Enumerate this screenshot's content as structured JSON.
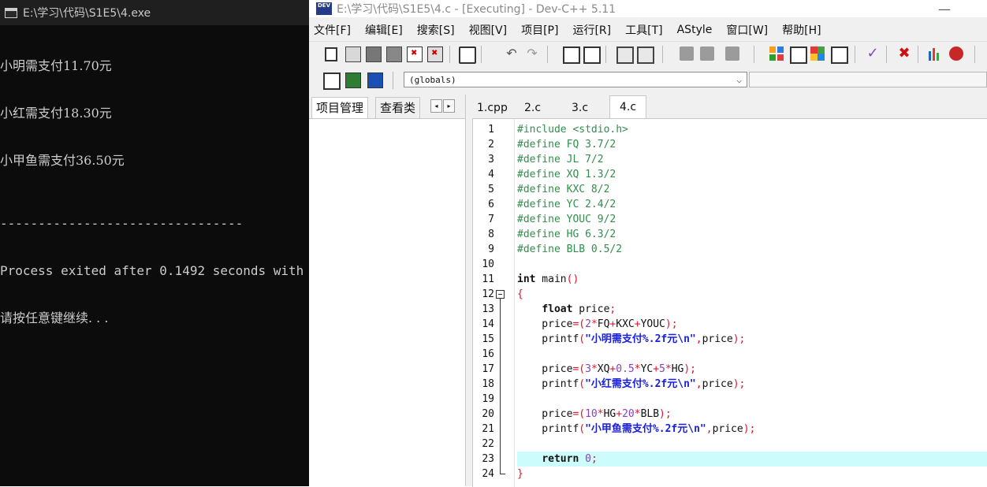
{
  "console": {
    "title": "E:\\学习\\代码\\S1E5\\4.exe",
    "lines": [
      "小明需支付11.70元",
      "小红需支付18.30元",
      "小甲鱼需支付36.50元"
    ],
    "separator": "--------------------------------",
    "exit_message": "Process exited after 0.1492 seconds with",
    "press_key": "请按任意键继续. . ."
  },
  "ide": {
    "title": "E:\\学习\\代码\\S1E5\\4.c - [Executing] - Dev-C++ 5.11",
    "app_icon_text": "DEV",
    "minimize": "—",
    "menu": [
      "文件[F]",
      "编辑[E]",
      "搜索[S]",
      "视图[V]",
      "项目[P]",
      "运行[R]",
      "工具[T]",
      "AStyle",
      "窗口[W]",
      "帮助[H]"
    ],
    "toolbar_icons": {
      "undo": "↶",
      "redo": "↷",
      "check": "✓",
      "stop": "✖"
    },
    "globals_combo": "(globals)",
    "globals_arrow": "⌵",
    "left_panel": {
      "tab_project": "项目管理",
      "tab_class": "查看类",
      "arrow_left": "◂",
      "arrow_right": "▸"
    },
    "editor_tabs": [
      "1.cpp",
      "2.c",
      "3.c",
      "4.c"
    ],
    "active_tab": "4.c"
  },
  "code": {
    "lines": [
      [
        {
          "t": "#include <stdio.h>",
          "c": "pp"
        }
      ],
      [
        {
          "t": "#define FQ 3.7/2",
          "c": "pp"
        }
      ],
      [
        {
          "t": "#define JL 7/2",
          "c": "pp"
        }
      ],
      [
        {
          "t": "#define XQ 1.3/2",
          "c": "pp"
        }
      ],
      [
        {
          "t": "#define KXC 8/2",
          "c": "pp"
        }
      ],
      [
        {
          "t": "#define YC 2.4/2",
          "c": "pp"
        }
      ],
      [
        {
          "t": "#define YOUC 9/2",
          "c": "pp"
        }
      ],
      [
        {
          "t": "#define HG 6.3/2",
          "c": "pp"
        }
      ],
      [
        {
          "t": "#define BLB 0.5/2",
          "c": "pp"
        }
      ],
      [],
      [
        {
          "t": "int",
          "c": "kw"
        },
        {
          "t": " main",
          "c": "plain"
        },
        {
          "t": "()",
          "c": "op"
        }
      ],
      [
        {
          "t": "{",
          "c": "op"
        }
      ],
      [
        {
          "t": "    ",
          "c": "plain"
        },
        {
          "t": "float",
          "c": "kw"
        },
        {
          "t": " price",
          "c": "plain"
        },
        {
          "t": ";",
          "c": "op"
        }
      ],
      [
        {
          "t": "    price",
          "c": "plain"
        },
        {
          "t": "=(",
          "c": "op"
        },
        {
          "t": "2",
          "c": "num"
        },
        {
          "t": "*",
          "c": "op"
        },
        {
          "t": "FQ",
          "c": "plain"
        },
        {
          "t": "+",
          "c": "op"
        },
        {
          "t": "KXC",
          "c": "plain"
        },
        {
          "t": "+",
          "c": "op"
        },
        {
          "t": "YOUC",
          "c": "plain"
        },
        {
          "t": ");",
          "c": "op"
        }
      ],
      [
        {
          "t": "    printf",
          "c": "plain"
        },
        {
          "t": "(",
          "c": "op"
        },
        {
          "t": "\"小明需支付%.2f元\\n\"",
          "c": "str"
        },
        {
          "t": ",",
          "c": "op"
        },
        {
          "t": "price",
          "c": "plain"
        },
        {
          "t": ");",
          "c": "op"
        }
      ],
      [],
      [
        {
          "t": "    price",
          "c": "plain"
        },
        {
          "t": "=(",
          "c": "op"
        },
        {
          "t": "3",
          "c": "num"
        },
        {
          "t": "*",
          "c": "op"
        },
        {
          "t": "XQ",
          "c": "plain"
        },
        {
          "t": "+",
          "c": "op"
        },
        {
          "t": "0.5",
          "c": "num"
        },
        {
          "t": "*",
          "c": "op"
        },
        {
          "t": "YC",
          "c": "plain"
        },
        {
          "t": "+",
          "c": "op"
        },
        {
          "t": "5",
          "c": "num"
        },
        {
          "t": "*",
          "c": "op"
        },
        {
          "t": "HG",
          "c": "plain"
        },
        {
          "t": ");",
          "c": "op"
        }
      ],
      [
        {
          "t": "    printf",
          "c": "plain"
        },
        {
          "t": "(",
          "c": "op"
        },
        {
          "t": "\"小红需支付%.2f元\\n\"",
          "c": "str"
        },
        {
          "t": ",",
          "c": "op"
        },
        {
          "t": "price",
          "c": "plain"
        },
        {
          "t": ");",
          "c": "op"
        }
      ],
      [],
      [
        {
          "t": "    price",
          "c": "plain"
        },
        {
          "t": "=(",
          "c": "op"
        },
        {
          "t": "10",
          "c": "num"
        },
        {
          "t": "*",
          "c": "op"
        },
        {
          "t": "HG",
          "c": "plain"
        },
        {
          "t": "+",
          "c": "op"
        },
        {
          "t": "20",
          "c": "num"
        },
        {
          "t": "*",
          "c": "op"
        },
        {
          "t": "BLB",
          "c": "plain"
        },
        {
          "t": ");",
          "c": "op"
        }
      ],
      [
        {
          "t": "    printf",
          "c": "plain"
        },
        {
          "t": "(",
          "c": "op"
        },
        {
          "t": "\"小甲鱼需支付%.2f元\\n\"",
          "c": "str"
        },
        {
          "t": ",",
          "c": "op"
        },
        {
          "t": "price",
          "c": "plain"
        },
        {
          "t": ");",
          "c": "op"
        }
      ],
      [],
      [
        {
          "t": "    ",
          "c": "plain"
        },
        {
          "t": "return",
          "c": "kw"
        },
        {
          "t": " ",
          "c": "plain"
        },
        {
          "t": "0",
          "c": "num"
        },
        {
          "t": ";",
          "c": "op"
        }
      ],
      [
        {
          "t": "}",
          "c": "op"
        }
      ]
    ],
    "highlight_line": 23
  },
  "colors": {
    "preprocessor": "#2f8f4b",
    "string": "#1a20e0",
    "number": "#8a3fbf",
    "operator": "#e0142c",
    "current_line": "#ccfcfc",
    "console_bg": "#0c0c0c",
    "console_text": "#cccccc"
  }
}
